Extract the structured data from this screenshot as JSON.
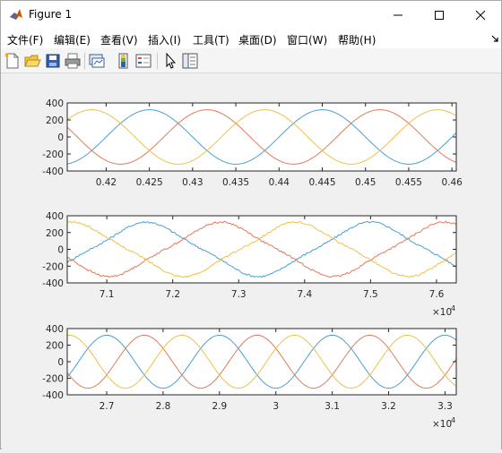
{
  "window": {
    "title": "Figure 1"
  },
  "menu": [
    {
      "label": "文件(F)"
    },
    {
      "label": "编辑(E)"
    },
    {
      "label": "查看(V)"
    },
    {
      "label": "插入(I)"
    },
    {
      "label": "工具(T)"
    },
    {
      "label": "桌面(D)"
    },
    {
      "label": "窗口(W)"
    },
    {
      "label": "帮助(H)"
    }
  ],
  "toolbar": [
    {
      "icon": "new-figure-icon"
    },
    {
      "icon": "open-file-icon"
    },
    {
      "icon": "save-icon"
    },
    {
      "icon": "print-icon"
    },
    {
      "icon": "link-plot-icon"
    },
    {
      "icon": "insert-colorbar-icon"
    },
    {
      "icon": "insert-legend-icon"
    },
    {
      "icon": "pointer-icon"
    },
    {
      "icon": "property-inspector-icon"
    }
  ],
  "colors": {
    "phase_a": "#4a9fd4",
    "phase_b": "#e07b5a",
    "phase_c": "#edc148"
  },
  "chart_data": [
    {
      "type": "line",
      "title": "",
      "xlim": [
        0.4155,
        0.4605
      ],
      "ylim": [
        -400,
        400
      ],
      "xticks": [
        0.42,
        0.425,
        0.43,
        0.435,
        0.44,
        0.445,
        0.45,
        0.455,
        0.46
      ],
      "xtick_labels": [
        "0.42",
        "0.425",
        "0.43",
        "0.435",
        "0.44",
        "0.445",
        "0.45",
        "0.455",
        "0.46"
      ],
      "yticks": [
        -400,
        -200,
        0,
        200,
        400
      ],
      "ytick_labels": [
        "-400",
        "-200",
        "0",
        "200",
        "400"
      ],
      "exponent_label": "",
      "series": [
        {
          "amplitude": 320,
          "period": 0.02,
          "peak_x": 0.425,
          "color": "#4a9fd4"
        },
        {
          "amplitude": 320,
          "period": 0.02,
          "peak_x": 0.43167,
          "color": "#e07b5a"
        },
        {
          "amplitude": 320,
          "period": 0.02,
          "peak_x": 0.41833,
          "color": "#edc148"
        }
      ]
    },
    {
      "type": "line",
      "title": "",
      "xlim": [
        70400,
        76300
      ],
      "ylim": [
        -400,
        400
      ],
      "xticks": [
        71000,
        72000,
        73000,
        74000,
        75000,
        76000
      ],
      "xtick_labels": [
        "7.1",
        "7.2",
        "7.3",
        "7.4",
        "7.5",
        "7.6"
      ],
      "yticks": [
        -400,
        -200,
        0,
        200,
        400
      ],
      "ytick_labels": [
        "-400",
        "-200",
        "0",
        "200",
        "400"
      ],
      "exponent_label": "×10",
      "exponent_power": "4",
      "series": [
        {
          "amplitude": 300,
          "period": 3400,
          "peak_x": 71600,
          "color": "#4a9fd4",
          "distorted": true
        },
        {
          "amplitude": 300,
          "period": 3400,
          "peak_x": 72733,
          "color": "#e07b5a",
          "distorted": true
        },
        {
          "amplitude": 300,
          "period": 3400,
          "peak_x": 70467,
          "color": "#edc148",
          "distorted": true
        }
      ]
    },
    {
      "type": "line",
      "title": "",
      "xlim": [
        26300,
        33200
      ],
      "ylim": [
        -400,
        400
      ],
      "xticks": [
        27000,
        28000,
        29000,
        30000,
        31000,
        32000,
        33000
      ],
      "xtick_labels": [
        "2.7",
        "2.8",
        "2.9",
        "3",
        "3.1",
        "3.2",
        "3.3"
      ],
      "yticks": [
        -400,
        -200,
        0,
        200,
        400
      ],
      "ytick_labels": [
        "-400",
        "-200",
        "0",
        "200",
        "400"
      ],
      "exponent_label": "×10",
      "exponent_power": "4",
      "series": [
        {
          "amplitude": 320,
          "period": 2000,
          "peak_x": 27000,
          "color": "#4a9fd4"
        },
        {
          "amplitude": 320,
          "period": 2000,
          "peak_x": 27667,
          "color": "#e07b5a"
        },
        {
          "amplitude": 320,
          "period": 2000,
          "peak_x": 28333,
          "color": "#edc148"
        }
      ]
    }
  ]
}
